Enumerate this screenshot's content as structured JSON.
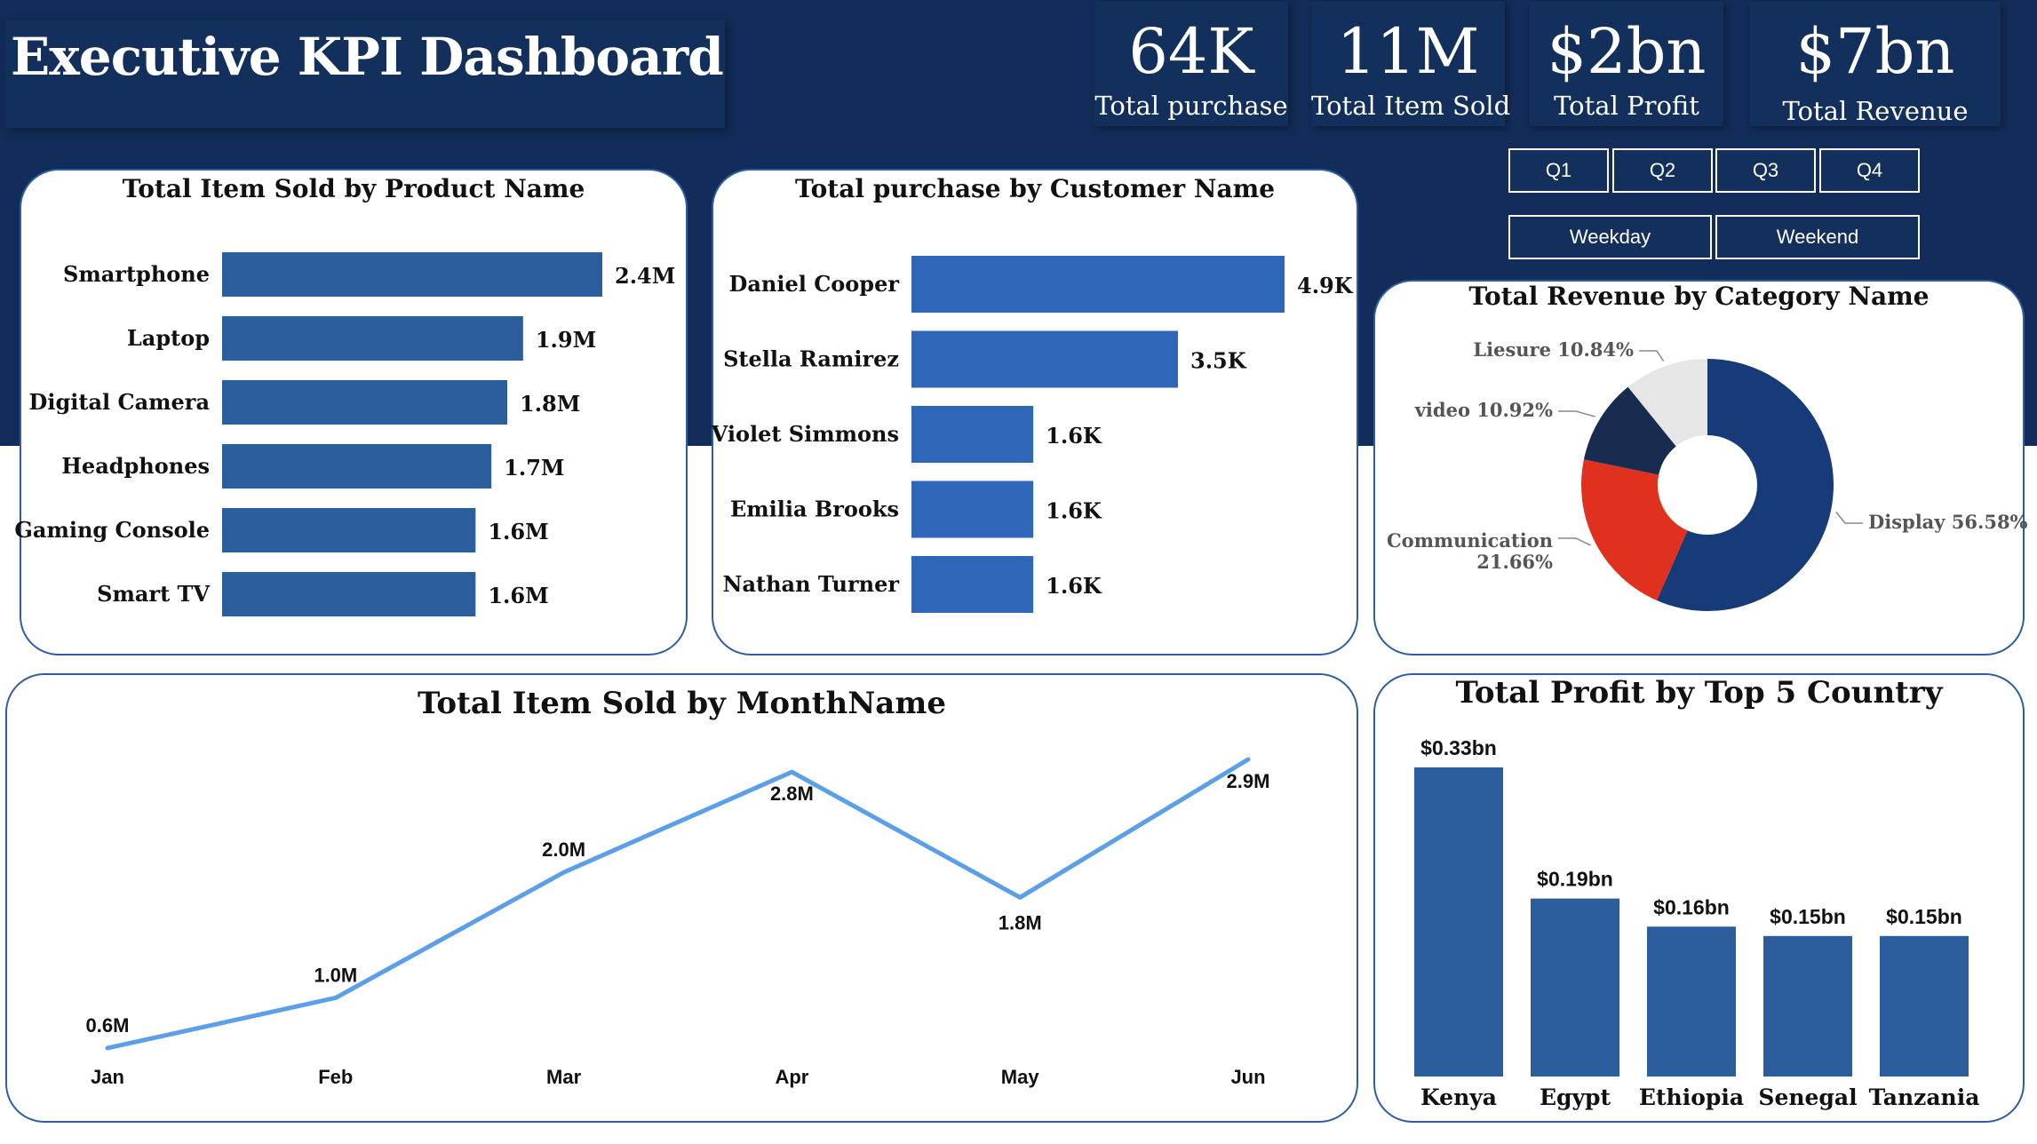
{
  "header": {
    "title": "Executive KPI Dashboard",
    "kpis": [
      {
        "value": "64K",
        "label": "Total purchase"
      },
      {
        "value": "11M",
        "label": "Total Item Sold"
      },
      {
        "value": "$2bn",
        "label": "Total Profit"
      },
      {
        "value": "$7bn",
        "label": "Total Revenue"
      }
    ]
  },
  "slicers": {
    "quarters": [
      "Q1",
      "Q2",
      "Q3",
      "Q4"
    ],
    "daytypes": [
      "Weekday",
      "Weekend"
    ]
  },
  "colors": {
    "header_bg": "#122d59",
    "bar": "#2c5d9c",
    "bar_bright": "#2e66b8",
    "line": "#5b9fe8",
    "pie": [
      "#173a78",
      "#e0311e",
      "#172c4e",
      "#e6e6e6"
    ]
  },
  "chart_data": [
    {
      "type": "bar",
      "orientation": "horizontal",
      "title": "Total Item Sold by Product Name",
      "categories": [
        "Smartphone",
        "Laptop",
        "Digital Camera",
        "Headphones",
        "Gaming Console",
        "Smart TV"
      ],
      "values": [
        2.4,
        1.9,
        1.8,
        1.7,
        1.6,
        1.6
      ],
      "value_labels": [
        "2.4M",
        "1.9M",
        "1.8M",
        "1.7M",
        "1.6M",
        "1.6M"
      ],
      "xlim": [
        0,
        2.4
      ],
      "grid": false
    },
    {
      "type": "bar",
      "orientation": "horizontal",
      "title": "Total purchase by Customer Name",
      "categories": [
        "Daniel Cooper",
        "Stella Ramirez",
        "Violet Simmons",
        "Emilia Brooks",
        "Nathan Turner"
      ],
      "values": [
        4.9,
        3.5,
        1.6,
        1.6,
        1.6
      ],
      "value_labels": [
        "4.9K",
        "3.5K",
        "1.6K",
        "1.6K",
        "1.6K"
      ],
      "xlim": [
        0,
        4.9
      ],
      "grid": false
    },
    {
      "type": "pie",
      "title": "Total Revenue by Category Name",
      "categories": [
        "Display",
        "Communication",
        "video",
        "Liesure"
      ],
      "values": [
        56.58,
        21.66,
        10.92,
        10.84
      ],
      "value_labels": [
        "Display 56.58%",
        "Communication 21.66%",
        "video 10.92%",
        "Liesure 10.84%"
      ],
      "donut": true
    },
    {
      "type": "line",
      "title": "Total Item Sold by MonthName",
      "categories": [
        "Jan",
        "Feb",
        "Mar",
        "Apr",
        "May",
        "Jun"
      ],
      "values": [
        0.6,
        1.0,
        2.0,
        2.8,
        1.8,
        2.9
      ],
      "value_labels": [
        "0.6M",
        "1.0M",
        "2.0M",
        "2.8M",
        "1.8M",
        "2.9M"
      ],
      "ylim": [
        0.6,
        2.9
      ],
      "grid": false
    },
    {
      "type": "bar",
      "orientation": "vertical",
      "title": "Total Profit by Top 5 Country",
      "categories": [
        "Kenya",
        "Egypt",
        "Ethiopia",
        "Senegal",
        "Tanzania"
      ],
      "values": [
        0.33,
        0.19,
        0.16,
        0.15,
        0.15
      ],
      "value_labels": [
        "$0.33bn",
        "$0.19bn",
        "$0.16bn",
        "$0.15bn",
        "$0.15bn"
      ],
      "ylim": [
        0,
        0.33
      ],
      "grid": false
    }
  ]
}
